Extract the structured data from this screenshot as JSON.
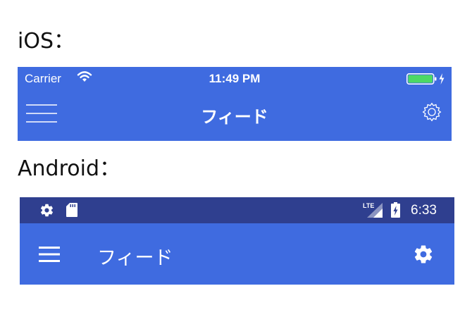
{
  "ios": {
    "section_label": "iOS：",
    "status": {
      "carrier": "Carrier",
      "time": "11:49 PM"
    },
    "nav": {
      "title": "フィード"
    }
  },
  "android": {
    "section_label": "Android：",
    "status": {
      "time": "6:33",
      "network": "LTE"
    },
    "toolbar": {
      "title": "フィード"
    }
  },
  "icons": {
    "ios_status": [
      "wifi-icon",
      "battery-icon",
      "charging-bolt-icon"
    ],
    "ios_nav": [
      "menu-icon",
      "gear-icon"
    ],
    "android_status": [
      "gear-icon",
      "sd-card-icon",
      "lte-signal-icon",
      "battery-charging-icon"
    ],
    "android_toolbar": [
      "menu-icon",
      "gear-icon"
    ]
  },
  "colors": {
    "app_bar": "#3f6be0",
    "android_status_bar": "#2f3f8f",
    "battery_fill": "#4cd964",
    "text": "#ffffff"
  }
}
